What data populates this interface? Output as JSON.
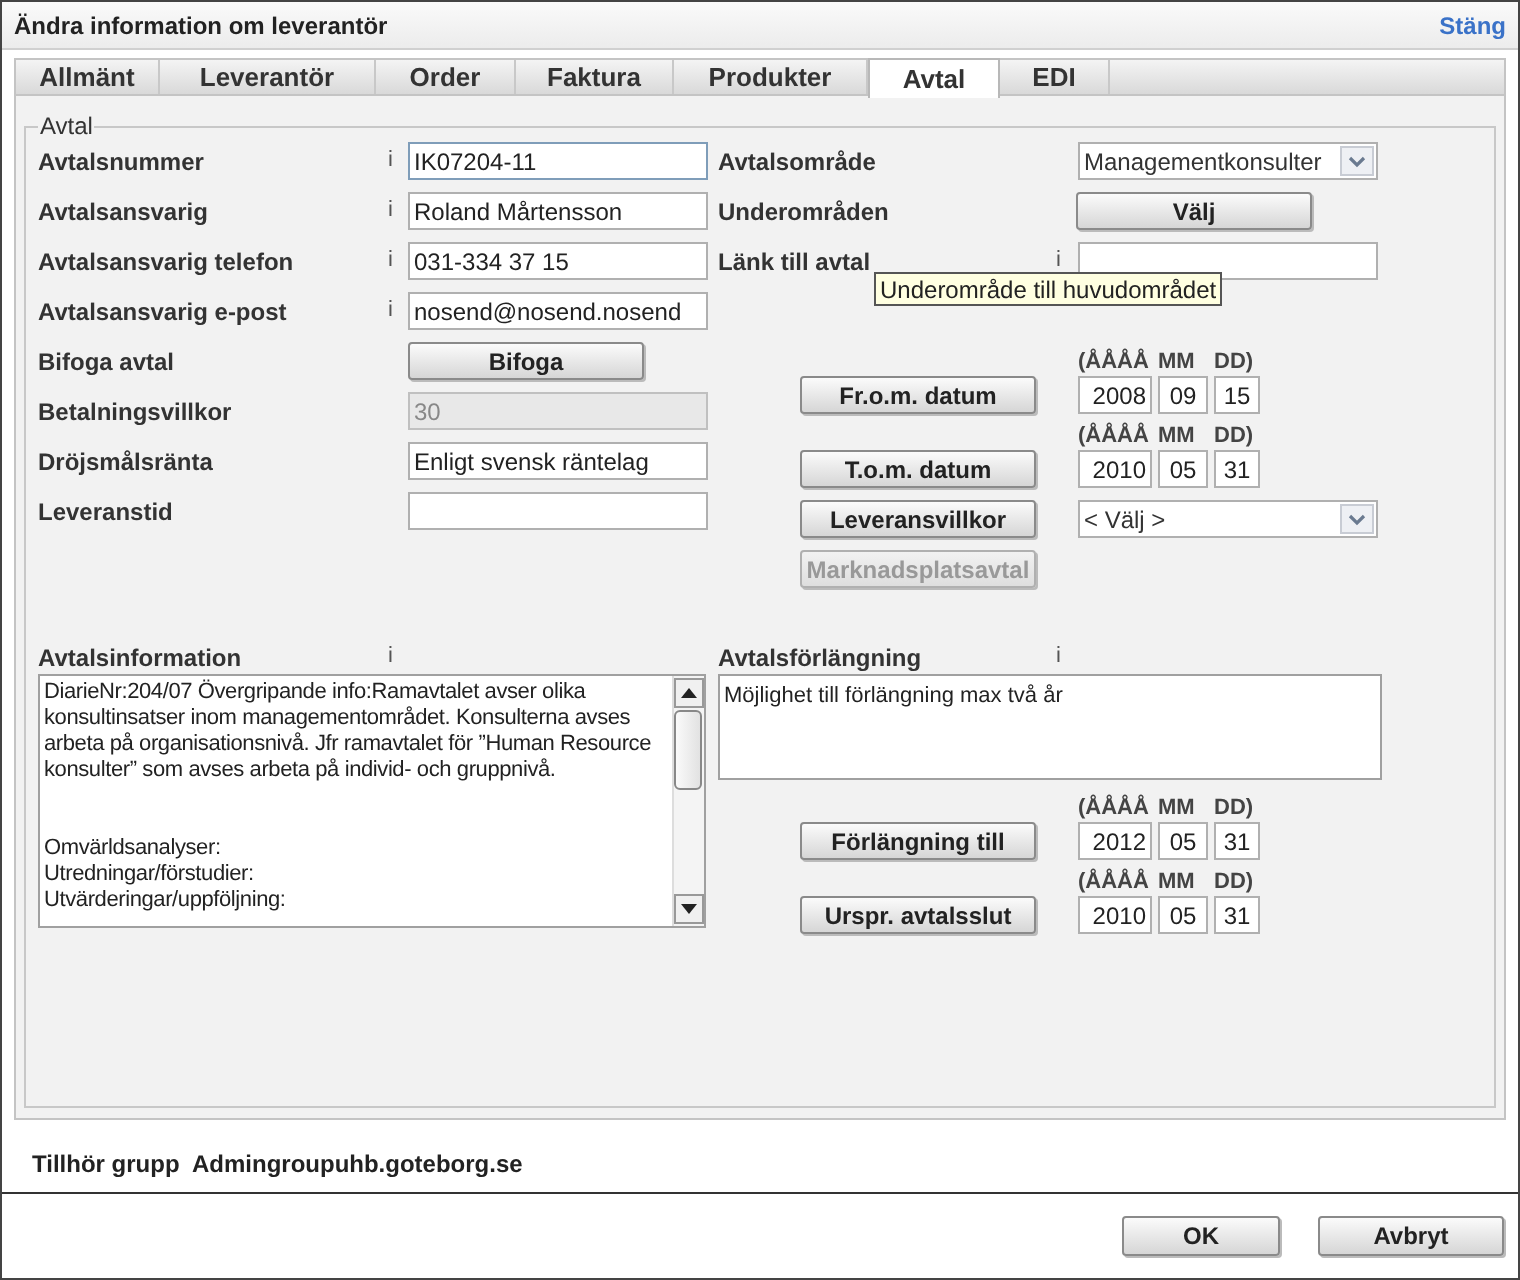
{
  "window": {
    "title": "Ändra information om leverantör",
    "close_link": "Stäng"
  },
  "tabs": [
    {
      "label": "Allmänt",
      "selected": false
    },
    {
      "label": "Leverantör",
      "selected": false
    },
    {
      "label": "Order",
      "selected": false
    },
    {
      "label": "Faktura",
      "selected": false
    },
    {
      "label": "Produkter",
      "selected": false
    },
    {
      "label": "Avtal",
      "selected": true
    },
    {
      "label": "EDI",
      "selected": false
    }
  ],
  "legend": "Avtal",
  "left_fields": [
    {
      "kind": "input",
      "label": "Avtalsnummer",
      "info": "i",
      "value": "IK07204-11",
      "focused": true,
      "disabled": false
    },
    {
      "kind": "input",
      "label": "Avtalsansvarig",
      "info": "i",
      "value": "Roland Mårtensson",
      "focused": false,
      "disabled": false
    },
    {
      "kind": "input",
      "label": "Avtalsansvarig telefon",
      "info": "i",
      "value": "031-334 37 15",
      "focused": false,
      "disabled": false
    },
    {
      "kind": "input",
      "label": "Avtalsansvarig e-post",
      "info": "i",
      "value": "nosend@nosend.nosend",
      "focused": false,
      "disabled": false
    },
    {
      "kind": "button",
      "label": "Bifoga avtal",
      "button": "Bifoga"
    },
    {
      "kind": "input",
      "label": "Betalningsvillkor",
      "value": "30",
      "focused": false,
      "disabled": true
    },
    {
      "kind": "input",
      "label": "Dröjsmålsränta",
      "value": "Enligt svensk räntelag",
      "focused": false,
      "disabled": false
    },
    {
      "kind": "input",
      "label": "Leveranstid",
      "focused": false,
      "disabled": false
    }
  ],
  "right_fields": [
    {
      "kind": "select",
      "label": "Avtalsområde",
      "value": "Managementkonsulter"
    },
    {
      "kind": "button",
      "label": "Underområden",
      "button": "Välj"
    },
    {
      "kind": "input",
      "label": "Länk till avtal",
      "info": "i"
    }
  ],
  "tooltip": "Underområde till huvudområdet",
  "dates": [
    {
      "button": "Fr.o.m. datum",
      "year_header": "(ÅÅÅÅ",
      "month_header": "MM",
      "day_header": "DD)",
      "year": "2008",
      "month": "09",
      "day": "15"
    },
    {
      "button": "T.o.m. datum",
      "year_header": "(ÅÅÅÅ",
      "month_header": "MM",
      "day_header": "DD)",
      "year": "2010",
      "month": "05",
      "day": "31"
    }
  ],
  "delivery_terms": {
    "button": "Leveransvillkor",
    "select": "< Välj >"
  },
  "marketplace_button": {
    "label": "Marknadsplatsavtal",
    "disabled": true
  },
  "agreement_info": {
    "label": "Avtalsinformation",
    "info": "i",
    "value": "DiarieNr:204/07 Övergripande info:Ramavtalet avser olika\nkonsultinsatser inom managementområdet. Konsulterna avses\narbeta på organisationsnivå. Jfr ramavtalet för ”Human Resource\nkonsulter” som avses arbeta på individ- och gruppnivå.\n\n\nOmvärldsanalyser:\nUtredningar/förstudier:\nUtvärderingar/uppföljning:"
  },
  "extension": {
    "label": "Avtalsförlängning",
    "info": "i",
    "value": "Möjlighet till förlängning max två år"
  },
  "extension_dates": [
    {
      "button": "Förlängning till",
      "year_header": "(ÅÅÅÅ",
      "month_header": "MM",
      "day_header": "DD)",
      "year": "2012",
      "month": "05",
      "day": "31"
    },
    {
      "button": "Urspr. avtalsslut",
      "year_header": "(ÅÅÅÅ",
      "month_header": "MM",
      "day_header": "DD)",
      "year": "2010",
      "month": "05",
      "day": "31"
    }
  ],
  "group": "Tillhör grupp  Admingroupuhb.goteborg.se",
  "buttons": [
    "OK",
    "Avbryt"
  ]
}
